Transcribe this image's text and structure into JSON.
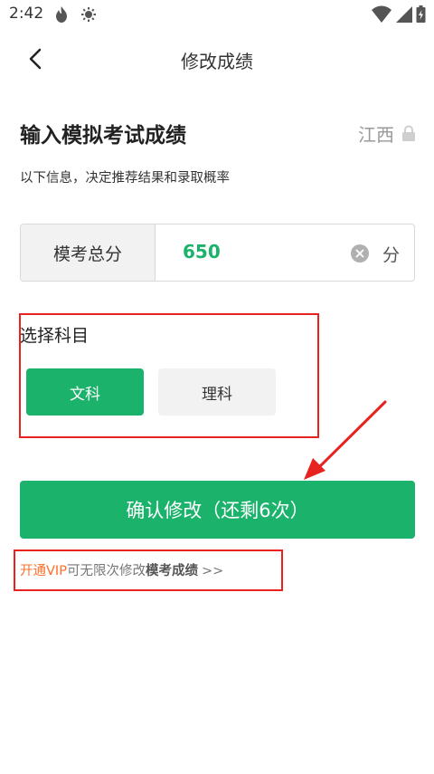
{
  "status_bar": {
    "time": "2:42"
  },
  "nav": {
    "title": "修改成绩"
  },
  "heading": {
    "title": "输入模拟考试成绩",
    "province": "江西"
  },
  "subtitle": "以下信息，决定推荐结果和录取概率",
  "score": {
    "label": "模考总分",
    "value": "650",
    "unit": "分"
  },
  "subject": {
    "title": "选择科目",
    "options": [
      {
        "label": "文科",
        "selected": true
      },
      {
        "label": "理科",
        "selected": false
      }
    ]
  },
  "confirm": {
    "label": "确认修改（还剩6次）"
  },
  "vip": {
    "part1": "开通VIP",
    "part2": "可无限次修改",
    "part3": "模考成绩",
    "part4": ">>"
  },
  "colors": {
    "accent": "#1bb36b",
    "annotation": "#e8221f",
    "vip": "#ff6f28"
  },
  "icons": {
    "status": [
      "flame-icon",
      "gear-icon",
      "wifi-icon",
      "signal-icon",
      "battery-icon"
    ],
    "nav": "chevron-left-icon",
    "province": "lock-icon",
    "input": "clear-icon"
  }
}
